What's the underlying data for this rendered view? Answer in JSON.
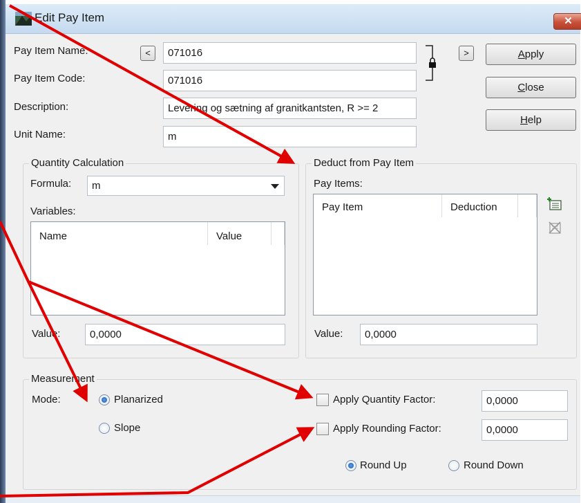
{
  "window": {
    "title": "Edit Pay Item",
    "close_glyph": "✕",
    "app_icon": "app-icon"
  },
  "form": {
    "pay_item_name_label": "Pay Item Name:",
    "pay_item_name_value": "071016",
    "prev_glyph": "<",
    "next_glyph": ">",
    "pay_item_code_label": "Pay Item Code:",
    "pay_item_code_value": "071016",
    "description_label": "Description:",
    "description_value": "Levering og sætning af granitkantsten, R >= 2",
    "unit_name_label": "Unit Name:",
    "unit_name_value": "m",
    "lock_icon": "lock-icon"
  },
  "buttons": {
    "apply_pre": "",
    "apply_u": "A",
    "apply_post": "pply",
    "close_pre": "",
    "close_u": "C",
    "close_post": "lose",
    "help_pre": "",
    "help_u": "H",
    "help_post": "elp"
  },
  "quantity": {
    "group_title": "Quantity Calculation",
    "formula_label": "Formula:",
    "formula_value": "m",
    "variables_label": "Variables:",
    "columns": [
      "Name",
      "Value"
    ],
    "value_label": "Value:",
    "value_value": "0,0000"
  },
  "deduct": {
    "group_title": "Deduct from Pay Item",
    "pay_items_label": "Pay Items:",
    "columns": [
      "Pay Item",
      "Deduction"
    ],
    "value_label": "Value:",
    "value_value": "0,0000",
    "add_icon": "add-deduction-icon",
    "remove_icon": "remove-deduction-icon"
  },
  "measurement": {
    "group_title": "Measurement",
    "mode_label": "Mode:",
    "planarized_label": "Planarized",
    "slope_label": "Slope",
    "selected_mode": "Planarized",
    "apply_quantity_factor_label": "Apply Quantity Factor:",
    "apply_quantity_factor_checked": false,
    "quantity_factor_value": "0,0000",
    "apply_rounding_factor_label": "Apply Rounding Factor:",
    "apply_rounding_factor_checked": false,
    "rounding_factor_value": "0,0000",
    "round_up_label": "Round Up",
    "round_down_label": "Round Down",
    "selected_rounding": "Round Up"
  },
  "annotation": {
    "arrow_color": "#e00000"
  }
}
